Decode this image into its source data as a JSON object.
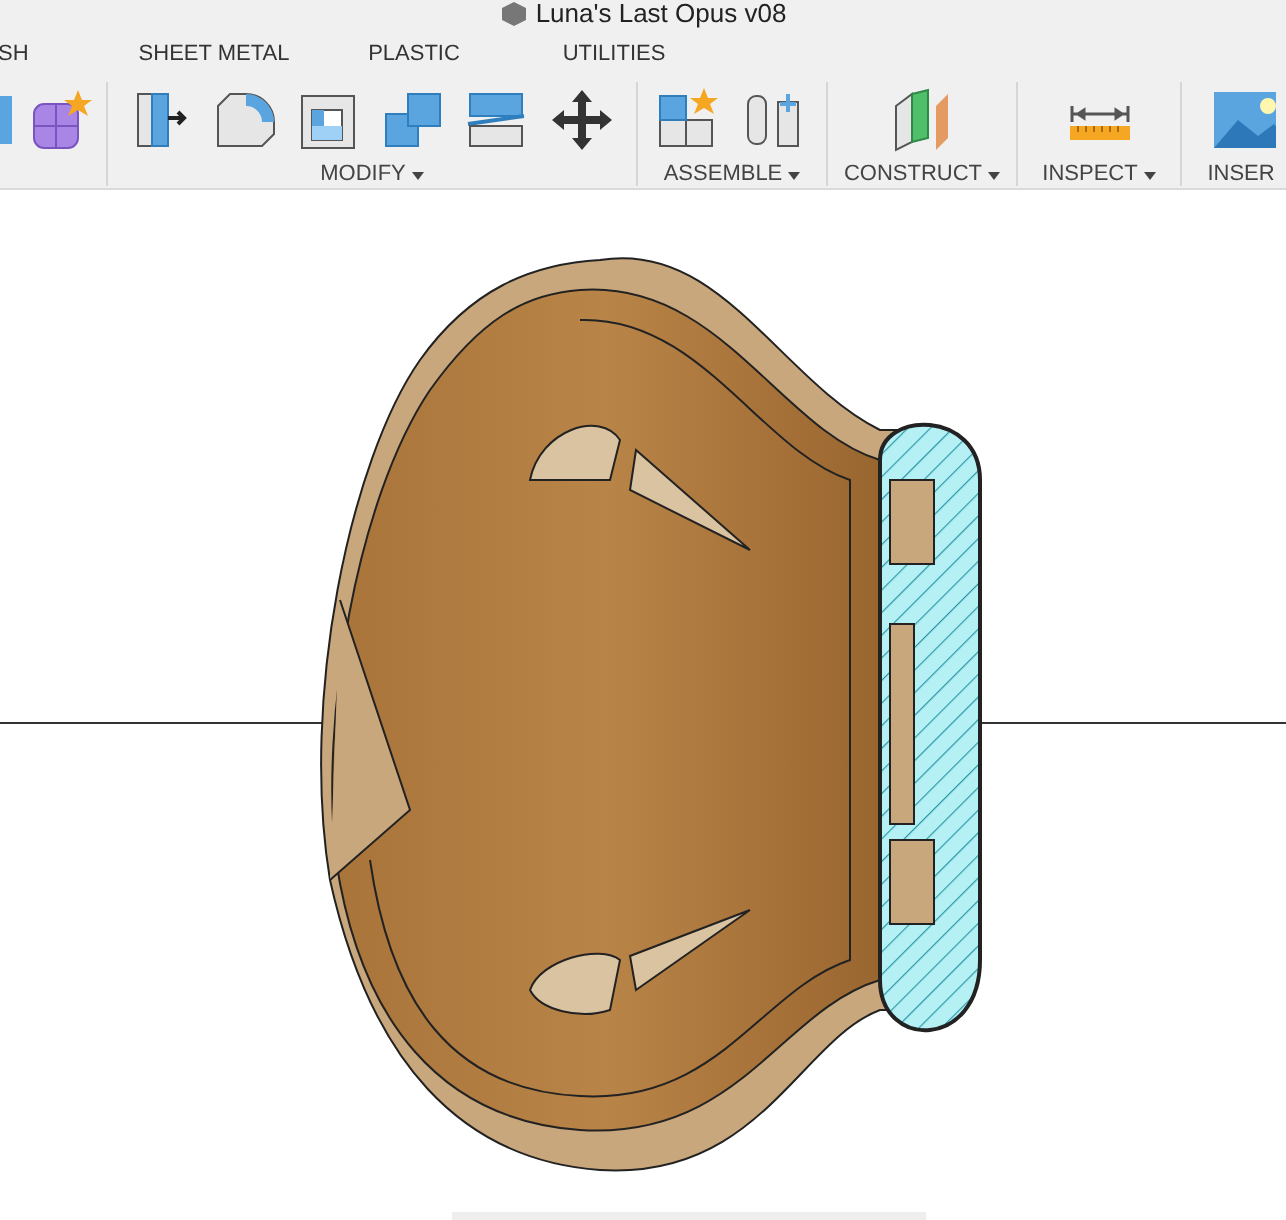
{
  "window": {
    "title": "Luna's Last Opus v08"
  },
  "tabs": [
    {
      "label": "SH"
    },
    {
      "label": "SHEET METAL"
    },
    {
      "label": "PLASTIC"
    },
    {
      "label": "UTILITIES"
    }
  ],
  "toolbar_groups": [
    {
      "kind": "partial"
    },
    {
      "kind": "modify",
      "label": "MODIFY",
      "dropdown": true
    },
    {
      "kind": "assemble",
      "label": "ASSEMBLE",
      "dropdown": true
    },
    {
      "kind": "construct",
      "label": "CONSTRUCT",
      "dropdown": true
    },
    {
      "kind": "inspect",
      "label": "INSPECT",
      "dropdown": true
    },
    {
      "kind": "insert",
      "label": "INSER",
      "dropdown": false
    }
  ]
}
